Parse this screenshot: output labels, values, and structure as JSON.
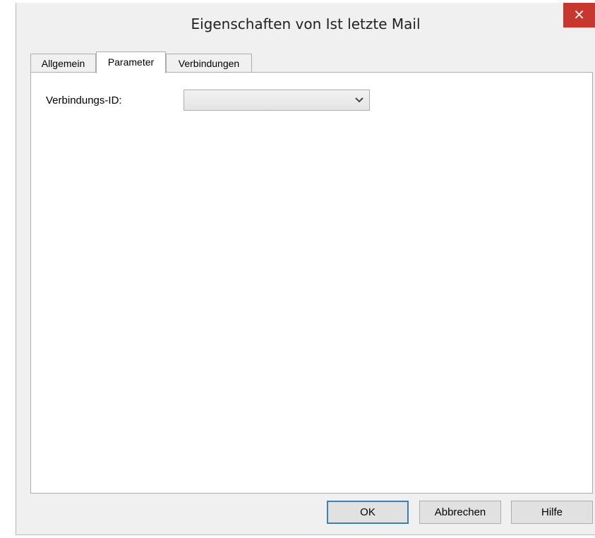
{
  "window": {
    "title": "Eigenschaften von Ist letzte Mail",
    "close_label": "×"
  },
  "tabs": [
    {
      "label": "Allgemein"
    },
    {
      "label": "Parameter"
    },
    {
      "label": "Verbindungen"
    }
  ],
  "active_tab": "Parameter",
  "form": {
    "connection_id_label": "Verbindungs-ID:",
    "connection_id_value": ""
  },
  "buttons": {
    "ok_label": "OK",
    "cancel_label": "Abbrechen",
    "help_label": "Hilfe"
  },
  "icons": {
    "close": "close-icon",
    "dropdown": "chevron-down-icon"
  },
  "colors": {
    "close_bg": "#c7372f",
    "default_button_border": "#3c7fb1",
    "dialog_bg": "#f0f0f0"
  }
}
